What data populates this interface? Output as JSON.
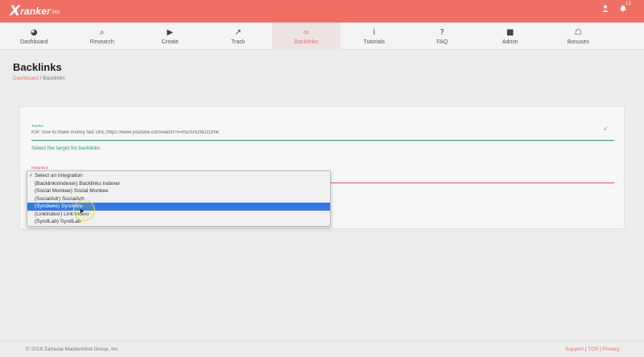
{
  "brand": {
    "x": "X",
    "name": "ranker",
    "suffix": "360"
  },
  "topbar": {
    "user_icon": "user-icon",
    "bell_icon": "bell-icon",
    "notification_count": "13"
  },
  "nav": [
    {
      "label": "Dashboard",
      "icon": "dashboard-icon",
      "glyph": "◕"
    },
    {
      "label": "Research",
      "icon": "search-icon",
      "glyph": "⌕"
    },
    {
      "label": "Create",
      "icon": "play-icon",
      "glyph": "▶"
    },
    {
      "label": "Track",
      "icon": "trending-up-icon",
      "glyph": "↗"
    },
    {
      "label": "Backlinks",
      "icon": "link-icon",
      "glyph": "∞"
    },
    {
      "label": "Tutorials",
      "icon": "info-icon",
      "glyph": "i"
    },
    {
      "label": "FAQ",
      "icon": "question-icon",
      "glyph": "?"
    },
    {
      "label": "Admin",
      "icon": "lock-icon",
      "glyph": "■"
    },
    {
      "label": "Bonuses",
      "icon": "gift-icon",
      "glyph": "☖"
    }
  ],
  "active_nav": "Backlinks",
  "page": {
    "title": "Backlinks",
    "breadcrumb": {
      "root": "Dashboard",
      "separator": "/",
      "current": "Backlinks"
    }
  },
  "form": {
    "tracker_label": "Tracker",
    "tracker_value": "KW: how to make money fast URL:https://www.youtube.com/watch?v=mDSnONOzDmk",
    "helper_text": "Select the target for backlinks",
    "integration_label": "Integration"
  },
  "dropdown": {
    "options": [
      "Select an Integration",
      "(BacklinksIndexer) Backlinks Indexer",
      "(Social Monkee) Social Monkee",
      "(SocialAdr) SocialAdr",
      "(Syndwire) Syndwire",
      "(LinkIndexr) Link Indexr",
      "(SyndLab) SyndLab"
    ],
    "selected_index": 0,
    "highlighted_index": 4
  },
  "footer": {
    "copyright": "© 2018 Zamurai Mastermind Group, Inc",
    "support": "Support",
    "tos": "TOS",
    "privacy": "Privacy",
    "separator": "|"
  },
  "colors": {
    "brand": "#ef7062",
    "success": "#2a9d6f",
    "error": "#e24c4c",
    "highlight": "#3478e5"
  }
}
